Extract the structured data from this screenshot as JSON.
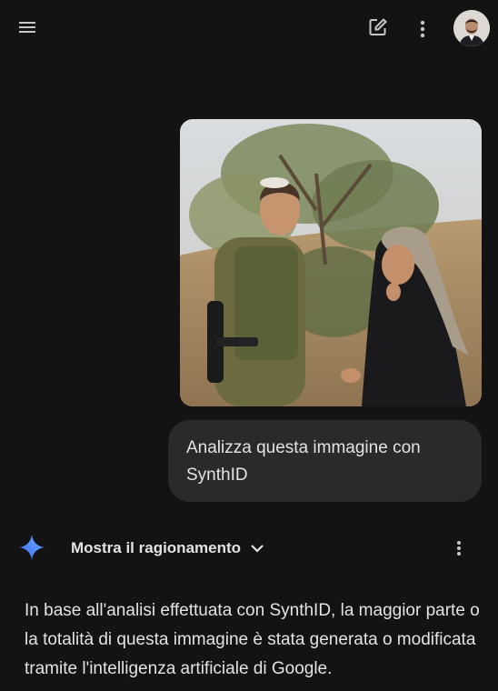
{
  "header": {
    "menu_icon": "hamburger-menu-icon",
    "new_chat_icon": "edit-pencil-icon",
    "more_icon": "more-vertical-icon",
    "avatar": "user-avatar"
  },
  "conversation": {
    "user_image": "uploaded-photo",
    "user_prompt": "Analizza questa immagine con SynthID",
    "assistant": {
      "logo_icon": "gemini-spark-icon",
      "reasoning_label": "Mostra il ragionamento",
      "reasoning_toggle_icon": "chevron-down-icon",
      "options_icon": "more-vertical-icon",
      "response": "In base all'analisi effettuata con SynthID, la maggior parte o la totalità di questa immagine è stata generata o modificata tramite l'intelligenza artificiale di Google."
    }
  },
  "colors": {
    "background": "#131314",
    "bubble": "#282a2c",
    "text": "#e3e3e3",
    "accent": "#4b8df8"
  }
}
